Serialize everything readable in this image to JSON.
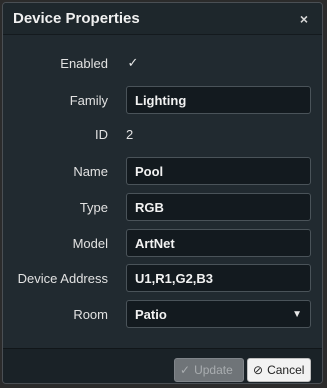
{
  "dialog": {
    "title": "Device Properties",
    "close_glyph": "×"
  },
  "form": {
    "enabled": {
      "label": "Enabled",
      "checked": true,
      "check_glyph": "✓"
    },
    "family": {
      "label": "Family",
      "value": "Lighting"
    },
    "id": {
      "label": "ID",
      "value": "2"
    },
    "name": {
      "label": "Name",
      "value": "Pool"
    },
    "type": {
      "label": "Type",
      "value": "RGB"
    },
    "model": {
      "label": "Model",
      "value": "ArtNet"
    },
    "device_address": {
      "label": "Device Address",
      "value": "U1,R1,G2,B3"
    },
    "room": {
      "label": "Room",
      "selected": "Patio",
      "caret_glyph": "▼"
    }
  },
  "footer": {
    "update": {
      "label": "Update",
      "icon": "checkmark-icon",
      "glyph": "✓",
      "disabled": true
    },
    "cancel": {
      "label": "Cancel",
      "icon": "ban-icon",
      "glyph": "⊘"
    }
  }
}
